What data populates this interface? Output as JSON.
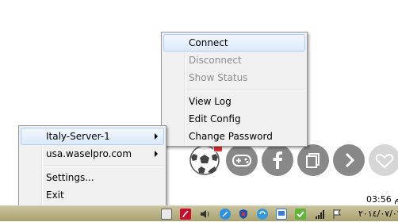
{
  "main_menu": {
    "items": [
      {
        "label": "Connect",
        "enabled": true,
        "highlighted": true
      },
      {
        "label": "Disconnect",
        "enabled": false
      },
      {
        "label": "Show Status",
        "enabled": false
      },
      {
        "label": "View Log",
        "enabled": true
      },
      {
        "label": "Edit Config",
        "enabled": true
      },
      {
        "label": "Change Password",
        "enabled": true
      }
    ]
  },
  "tray_menu": {
    "items": [
      {
        "label": "Italy-Server-1",
        "has_submenu": true,
        "highlighted": true
      },
      {
        "label": "usa.waselpro.com",
        "has_submenu": true
      },
      {
        "label": "Settings...",
        "has_submenu": false
      },
      {
        "label": "Exit",
        "has_submenu": false
      }
    ]
  },
  "share_buttons": [
    "gamepad-icon",
    "facebook-icon",
    "copy-icon",
    "chevron-right-icon",
    "heart-icon"
  ],
  "tray_icons": [
    "network-icon",
    "pdf-icon",
    "volume-icon",
    "browser-icon",
    "shield-icon",
    "sync-icon",
    "display-icon",
    "security-check-icon",
    "signal-icon",
    "flag-icon"
  ],
  "clock": {
    "time": "03:56 م",
    "date": "٢٠١٤/٠٧/٠٦"
  },
  "colors": {
    "menu_bg": "#f0f0f0",
    "highlight": "#dbe9fa",
    "disabled_text": "#8d8d8d",
    "taskbar": "#b5ae80",
    "button_gray": "#888888"
  }
}
